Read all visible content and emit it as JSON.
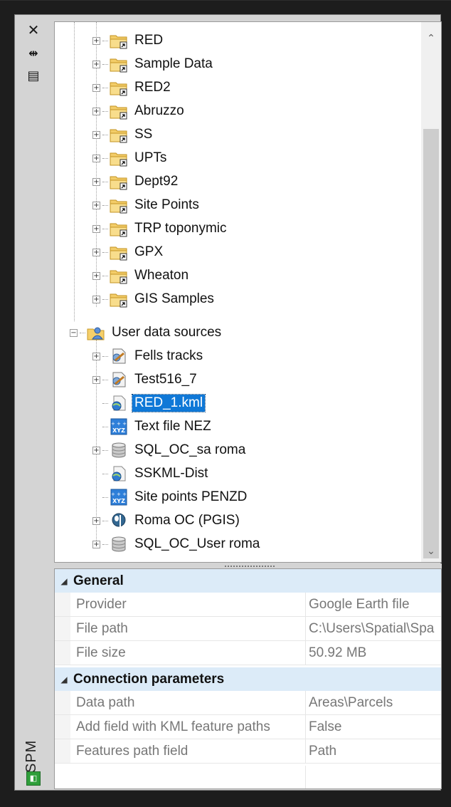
{
  "panel": {
    "strip": {
      "close_glyph": "✕",
      "autohide_glyph": "⇹",
      "properties_glyph": "▤",
      "title": "SPM"
    },
    "tree": {
      "folders": [
        {
          "label": "RED"
        },
        {
          "label": "Sample Data"
        },
        {
          "label": "RED2"
        },
        {
          "label": "Abruzzo"
        },
        {
          "label": "SS"
        },
        {
          "label": "UPTs"
        },
        {
          "label": "Dept92"
        },
        {
          "label": "Site Points"
        },
        {
          "label": "TRP toponymic"
        },
        {
          "label": "GPX"
        },
        {
          "label": "Wheaton"
        },
        {
          "label": "GIS Samples"
        }
      ],
      "user_data_sources": {
        "label": "User data sources",
        "items": [
          {
            "label": "Fells tracks",
            "icon": "shape-file-icon",
            "expandable": true
          },
          {
            "label": "Test516_7",
            "icon": "shape-file-icon",
            "expandable": true
          },
          {
            "label": "RED_1.kml",
            "icon": "kml-file-icon",
            "expandable": false,
            "selected": true
          },
          {
            "label": "Text file NEZ",
            "icon": "xyz-file-icon",
            "expandable": false
          },
          {
            "label": "SQL_OC_sa roma",
            "icon": "database-icon",
            "expandable": true
          },
          {
            "label": "SSKML-Dist",
            "icon": "kml-file-icon",
            "expandable": false
          },
          {
            "label": "Site points PENZD",
            "icon": "xyz-file-icon",
            "expandable": false
          },
          {
            "label": "Roma OC (PGIS)",
            "icon": "postgis-icon",
            "expandable": true
          },
          {
            "label": "SQL_OC_User roma",
            "icon": "database-icon",
            "expandable": true
          }
        ]
      }
    },
    "properties": {
      "general": {
        "title": "General",
        "rows": [
          {
            "name": "Provider",
            "value": "Google Earth file"
          },
          {
            "name": "File path",
            "value": "C:\\Users\\Spatial\\Spa"
          },
          {
            "name": "File size",
            "value": "50.92 MB"
          }
        ]
      },
      "connection": {
        "title": "Connection parameters",
        "rows": [
          {
            "name": "Data path",
            "value": "Areas\\Parcels"
          },
          {
            "name": "Add field with KML feature paths",
            "value": "False"
          },
          {
            "name": "Features path field",
            "value": "Path"
          }
        ]
      }
    }
  }
}
